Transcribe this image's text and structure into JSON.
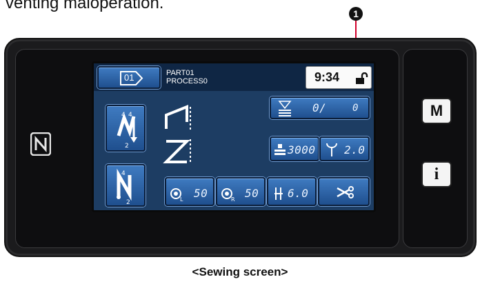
{
  "caption": {
    "top_text": "venting maloperation.",
    "callout_number": "1",
    "bottom_text": "<Sewing screen>"
  },
  "screen": {
    "header": {
      "pattern_no": "01",
      "part_line1": "PART01",
      "part_line2": "PROCESS0",
      "time": "9:34"
    },
    "counter": {
      "value": "0/",
      "sub": "0"
    },
    "speed": {
      "value": "3000"
    },
    "stitch_length": {
      "value": "2.0"
    },
    "tension_left": {
      "value": "50",
      "sub": "L"
    },
    "tension_right": {
      "value": "50",
      "sub": "R"
    },
    "presser_height": {
      "value": "6.0"
    },
    "reverse_top": {
      "top": "4",
      "bot": "2"
    },
    "reverse_bottom": {
      "top": "4",
      "bot": "2"
    }
  },
  "side_buttons": {
    "menu": "M",
    "info": "i"
  },
  "icons": [
    "nfc-icon",
    "lock-open-icon",
    "scissors-icon",
    "bobbin-counter-icon",
    "needle-speed-icon",
    "stitch-length-icon",
    "thread-tension-icon",
    "presser-foot-icon"
  ]
}
